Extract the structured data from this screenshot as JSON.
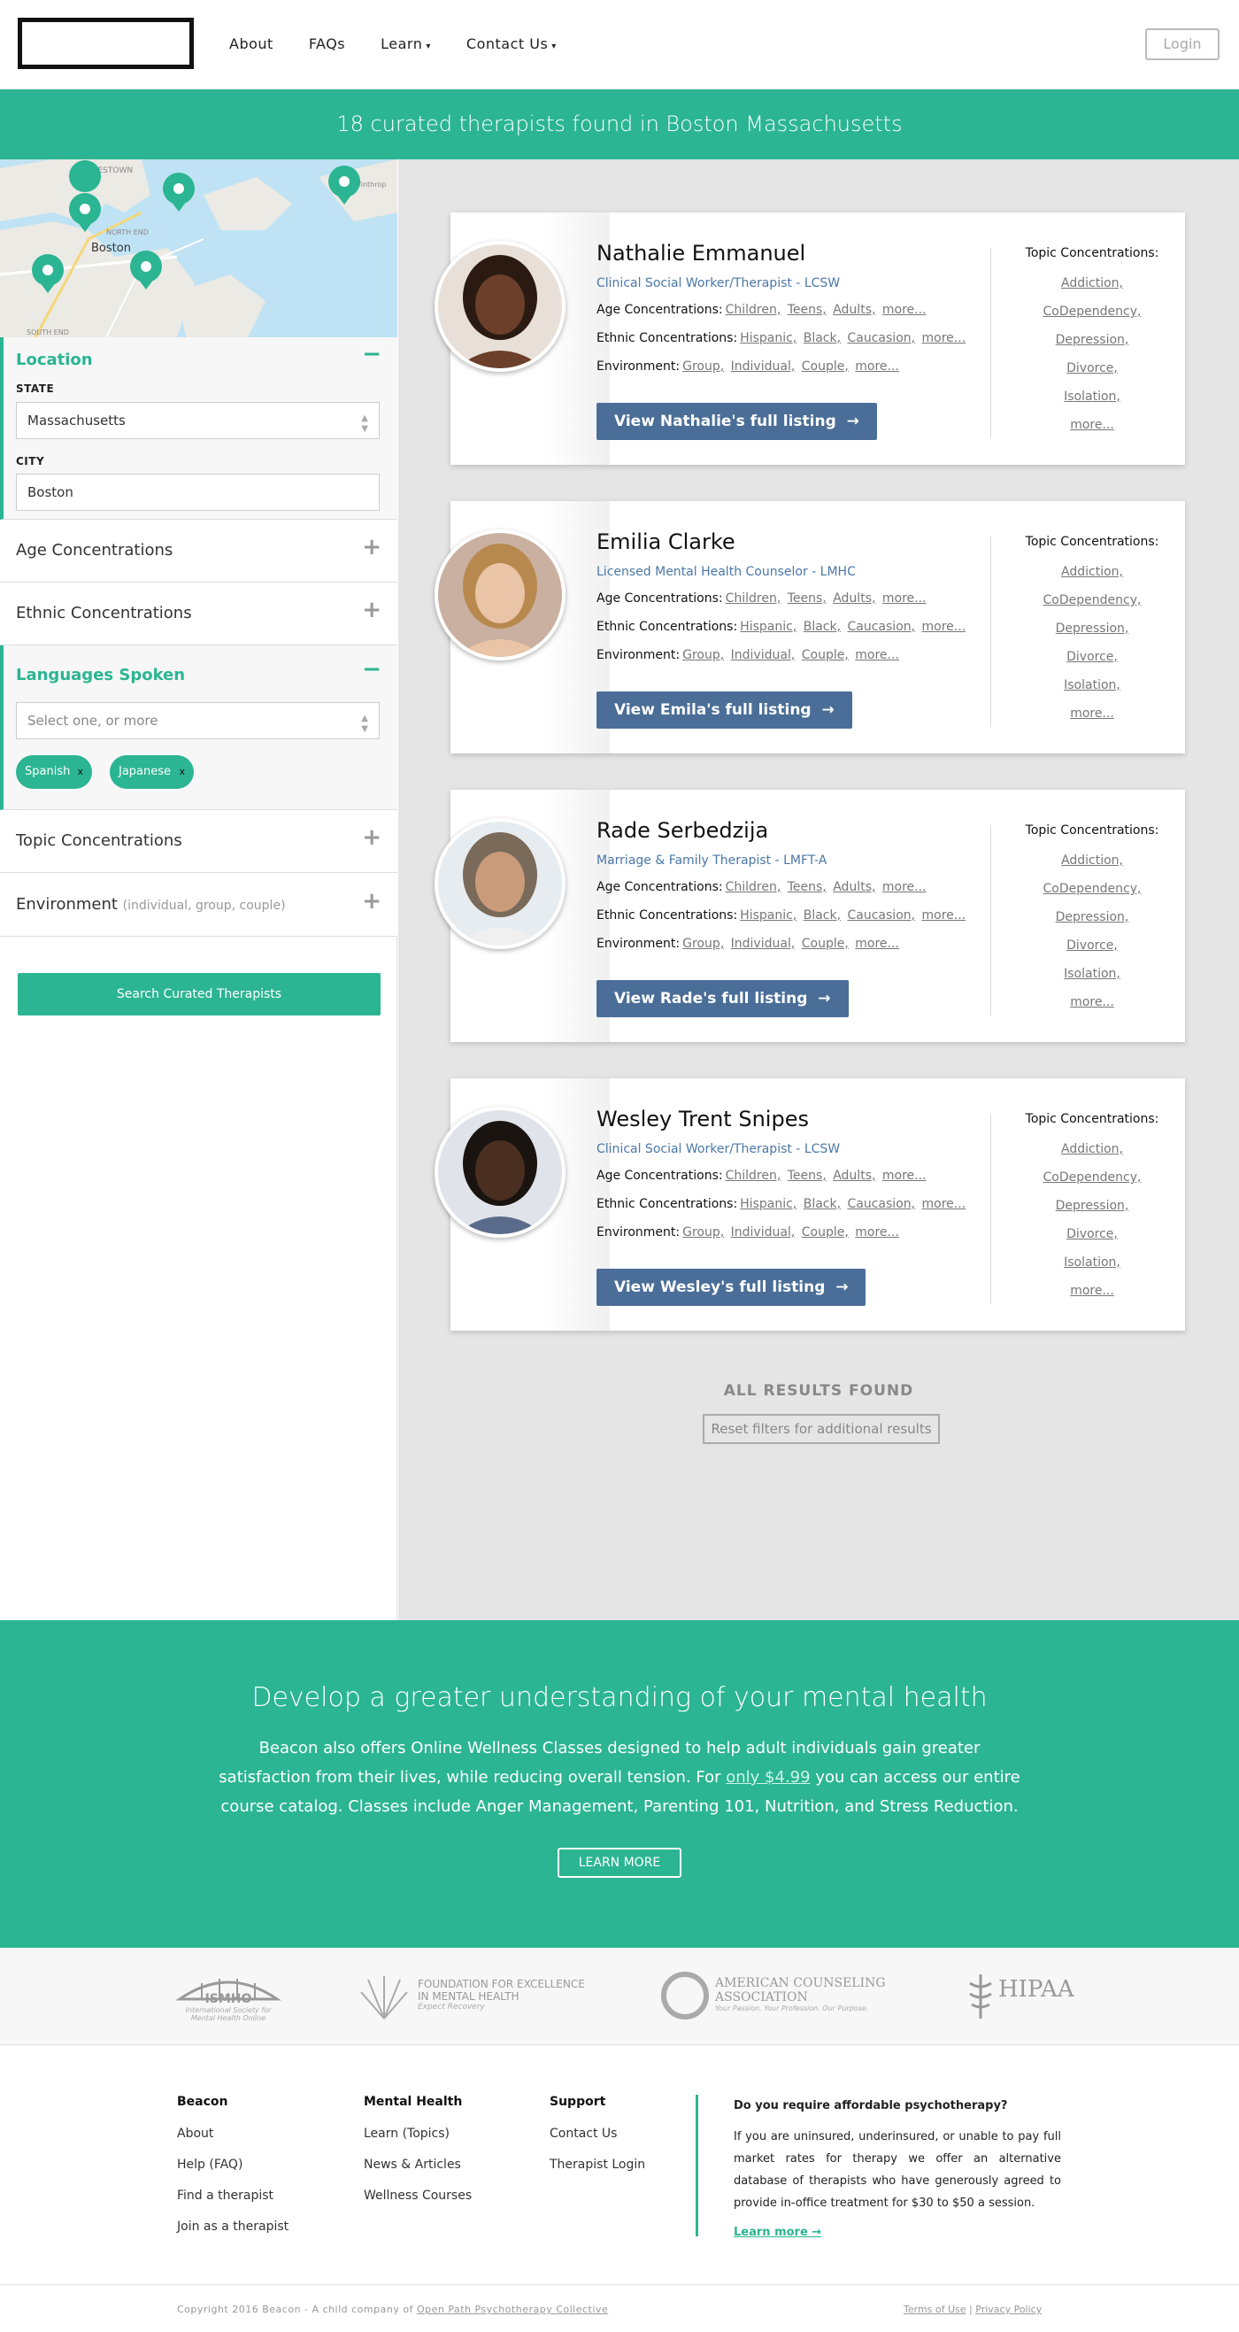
{
  "header": {
    "nav": [
      "About",
      "FAQs",
      "Learn",
      "Contact Us"
    ],
    "login": "Login"
  },
  "banner": "18 curated therapists found in Boston Massachusetts",
  "map": {
    "labels": [
      "CHARLESTOWN",
      "Boston",
      "NORTH END",
      "SOUTH END",
      "Winthrop"
    ]
  },
  "sidebar": {
    "location": {
      "title": "Location",
      "state_label": "STATE",
      "state_value": "Massachusetts",
      "city_label": "CITY",
      "city_value": "Boston"
    },
    "age": "Age Concentrations",
    "ethnic": "Ethnic Concentrations",
    "languages": {
      "title": "Languages Spoken",
      "placeholder": "Select one, or more",
      "chips": [
        "Spanish",
        "Japanese"
      ]
    },
    "topic": "Topic Concentrations",
    "environment": {
      "title": "Environment",
      "hint": "(individual, group, couple)"
    },
    "search_button": "Search Curated Therapists"
  },
  "labels": {
    "age": "Age Concentrations:",
    "ethnic": "Ethnic Concentrations:",
    "environment": "Environment:",
    "topics": "Topic Concentrations:"
  },
  "common": {
    "age": [
      "Children,",
      "Teens,",
      "Adults,",
      "more..."
    ],
    "ethnic": [
      "Hispanic,",
      "Black,",
      "Caucasion,",
      "more..."
    ],
    "environment": [
      "Group,",
      "Individual,",
      "Couple,",
      "more..."
    ],
    "topics": [
      "Addiction,",
      "CoDependency,",
      "Depression,",
      "Divorce,",
      "Isolation,",
      "more..."
    ]
  },
  "therapists": [
    {
      "name": "Nathalie Emmanuel",
      "title": "Clinical Social Worker/Therapist - LCSW",
      "button": "View Nathalie's full listing"
    },
    {
      "name": "Emilia Clarke",
      "title": "Licensed Mental Health Counselor - LMHC",
      "button": "View Emila's full listing"
    },
    {
      "name": "Rade Serbedzija",
      "title": "Marriage & Family Therapist - LMFT-A",
      "button": "View Rade's full listing"
    },
    {
      "name": "Wesley Trent Snipes",
      "title": "Clinical Social Worker/Therapist - LCSW",
      "button": "View Wesley's full listing"
    }
  ],
  "results_footer": {
    "all_found": "ALL RESULTS FOUND",
    "reset": "Reset filters for additional results"
  },
  "promo": {
    "heading": "Develop a greater understanding of your mental health",
    "text_1": "Beacon also offers Online Wellness Classes designed to help adult individuals gain greater satisfaction from their lives, while reducing overall tension. For",
    "price": "only $4.99",
    "text_2": "you can access our entire course catalog. Classes include Anger Management, Parenting 101, Nutrition, and Stress Reduction.",
    "button": "LEARN MORE"
  },
  "logos": {
    "ismho": {
      "name": "ISMHO",
      "sub": "International Society for Mental Health Online"
    },
    "fem": {
      "line1": "FOUNDATION FOR EXCELLENCE",
      "line2": "IN MENTAL HEALTH",
      "sub": "Expect Recovery"
    },
    "aca": {
      "line1": "AMERICAN COUNSELING",
      "line2": "ASSOCIATION",
      "sub": "Your Passion. Your Profession. Our Purpose."
    },
    "hipaa": {
      "name": "HIPAA"
    }
  },
  "footer": {
    "col1": {
      "title": "Beacon",
      "items": [
        "About",
        "Help (FAQ)",
        "Find a therapist",
        "Join as a therapist"
      ]
    },
    "col2": {
      "title": "Mental Health",
      "items": [
        "Learn (Topics)",
        "News & Articles",
        "Wellness Courses"
      ]
    },
    "col3": {
      "title": "Support",
      "items": [
        "Contact Us",
        "Therapist Login"
      ]
    },
    "promo": {
      "title": "Do you require affordable psychotherapy?",
      "text": "If you are uninsured, underinsured, or unable to pay full market rates for therapy we offer an alternative database of therapists who have generously agreed to provide in-office treatment for $30 to $50 a session.",
      "link": "Learn more →"
    },
    "copyright": "Copyright 2016 Beacon - A child company of",
    "copyright_link": "Open Path Psychotherapy Collective",
    "terms": "Terms of Use",
    "privacy": "Privacy Policy"
  }
}
